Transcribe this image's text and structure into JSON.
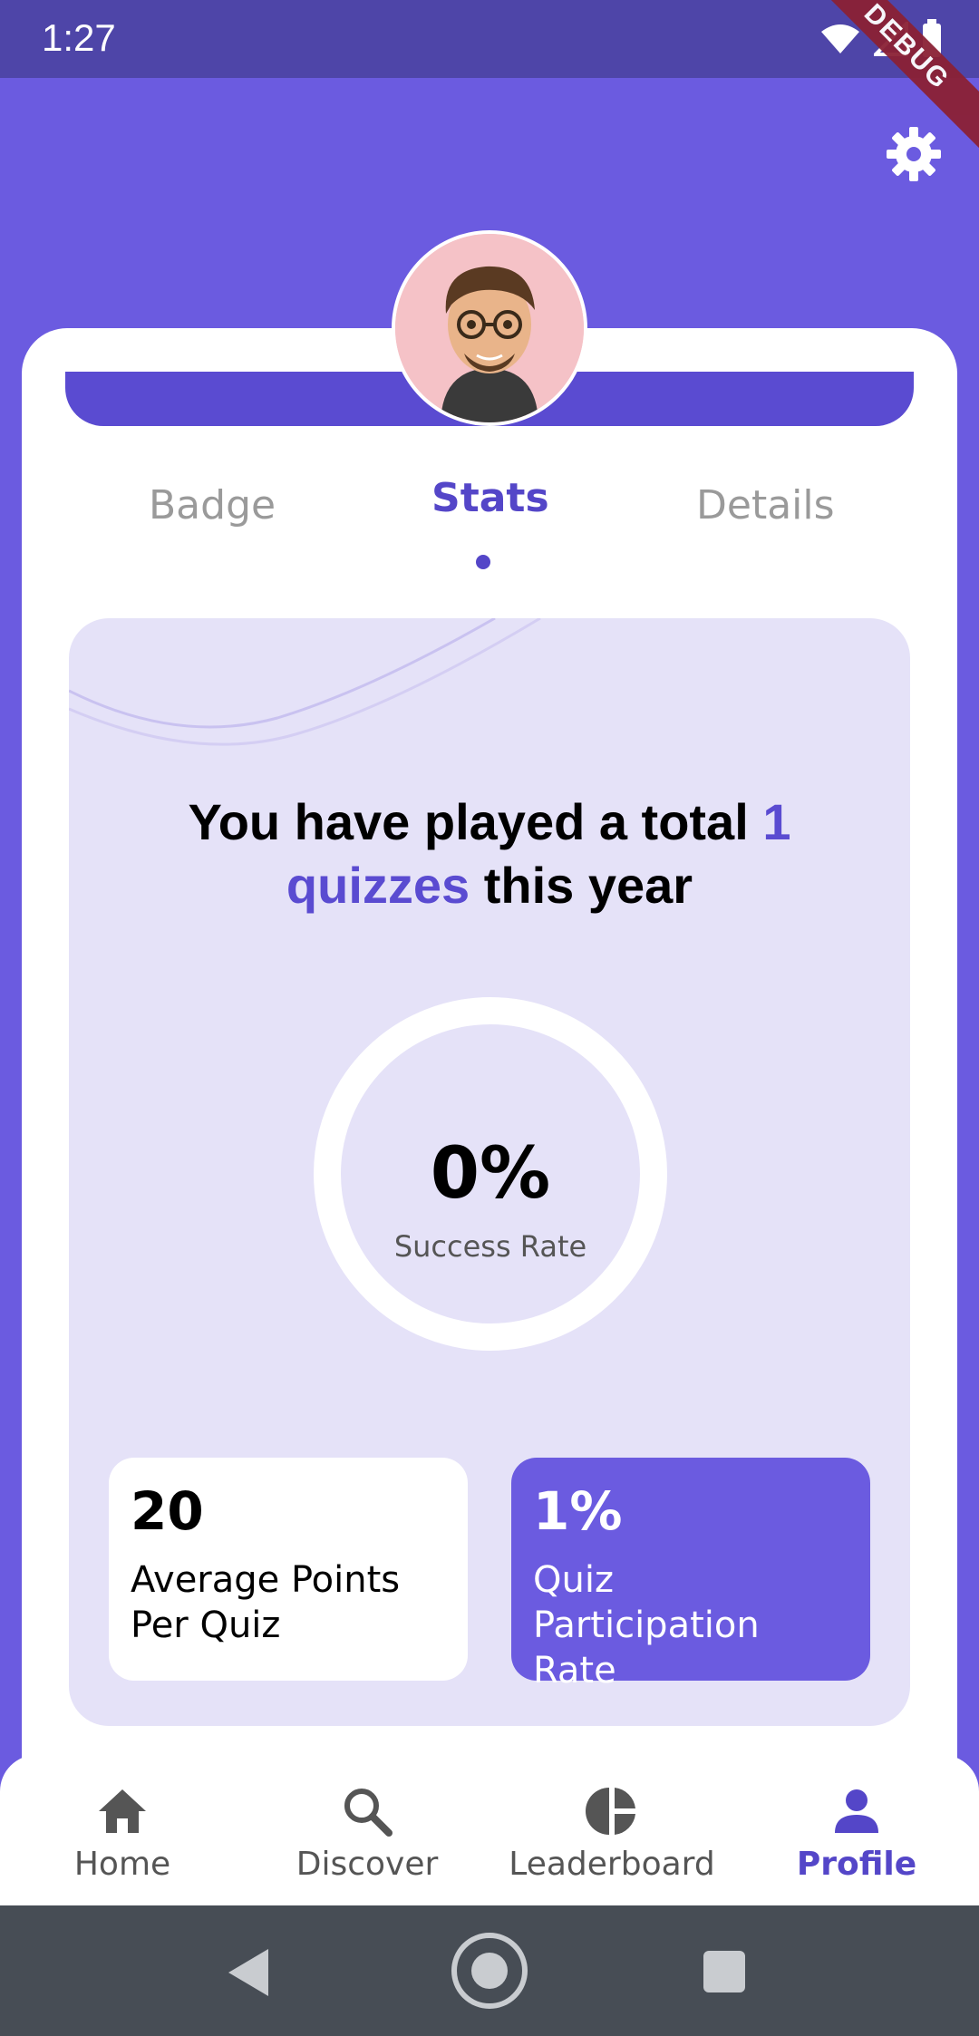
{
  "status_bar": {
    "time": "1:27",
    "battery_level": "76",
    "debug_label": "DEBUG"
  },
  "header": {
    "settings_icon": "gear-icon"
  },
  "profile": {
    "avatar_icon": "avatar-cartoon"
  },
  "tabs": [
    {
      "label": "Badge",
      "active": false
    },
    {
      "label": "Stats",
      "active": true
    },
    {
      "label": "Details",
      "active": false
    }
  ],
  "stats": {
    "headline_prefix": "You have played a total ",
    "headline_accent": "1 quizzes",
    "headline_suffix": " this year",
    "success_rate_value": "0%",
    "success_rate_label": "Success Rate",
    "success_rate_fraction": 0,
    "avg_points_value": "20",
    "avg_points_label": "Average Points Per Quiz",
    "participation_value": "1%",
    "participation_label": "Quiz Participation Rate"
  },
  "bottom_nav": [
    {
      "label": "Home",
      "icon": "home-icon",
      "active": false
    },
    {
      "label": "Discover",
      "icon": "search-icon",
      "active": false
    },
    {
      "label": "Leaderboard",
      "icon": "pie-chart-icon",
      "active": false
    },
    {
      "label": "Profile",
      "icon": "person-icon",
      "active": true
    }
  ],
  "colors": {
    "primary": "#6B5BE0",
    "accent": "#5446C8",
    "panel": "#E5E2F8",
    "statusbar": "#4E45A8",
    "system_nav": "#474D55"
  }
}
